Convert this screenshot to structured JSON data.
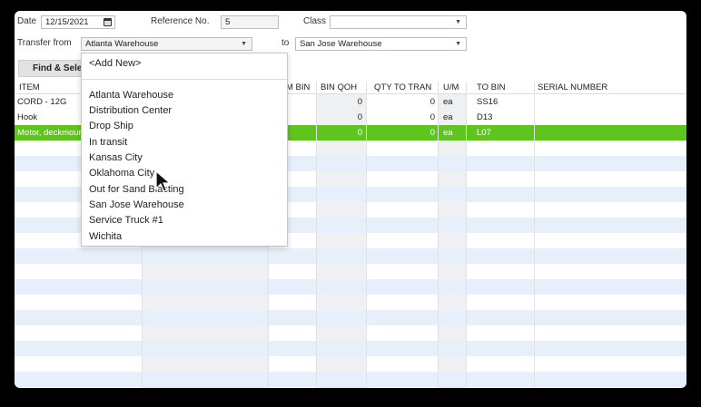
{
  "form": {
    "date_label": "Date",
    "date_value": "12/15/2021",
    "reference_label": "Reference No.",
    "reference_value": "5",
    "class_label": "Class",
    "class_value": "",
    "transfer_from_label": "Transfer from",
    "transfer_from_value": "Atlanta Warehouse",
    "to_label": "to",
    "to_value": "San Jose Warehouse",
    "find_select_label": "Find & Select"
  },
  "grid": {
    "headers": {
      "item": "ITEM",
      "from_bin": "M BIN",
      "bin_qoh": "BIN QOH",
      "qty_to_tran": "QTY TO TRAN",
      "um": "U/M",
      "to_bin": "TO BIN",
      "serial": "SERIAL NUMBER"
    },
    "rows": [
      {
        "item": "CORD - 12G",
        "bin_qoh": "0",
        "qty": "0",
        "um": "ea",
        "to_bin": "SS16",
        "selected": false
      },
      {
        "item": "Hook",
        "bin_qoh": "0",
        "qty": "0",
        "um": "ea",
        "to_bin": "D13",
        "selected": false
      },
      {
        "item": "Motor, deckmount",
        "bin_qoh": "0",
        "qty": "0",
        "um": "ea",
        "to_bin": "L07",
        "selected": true
      }
    ]
  },
  "dropdown": {
    "add_new": "<Add New>",
    "items": [
      "Atlanta Warehouse",
      "Distribution Center",
      "Drop Ship",
      "In transit",
      "Kansas City",
      "Oklahoma City",
      "Out for Sand Blasting",
      "San Jose Warehouse",
      "Service Truck #1",
      "Wichita"
    ]
  },
  "colors": {
    "selected_row": "#5ec41e",
    "alt_row": "#e6effa"
  }
}
